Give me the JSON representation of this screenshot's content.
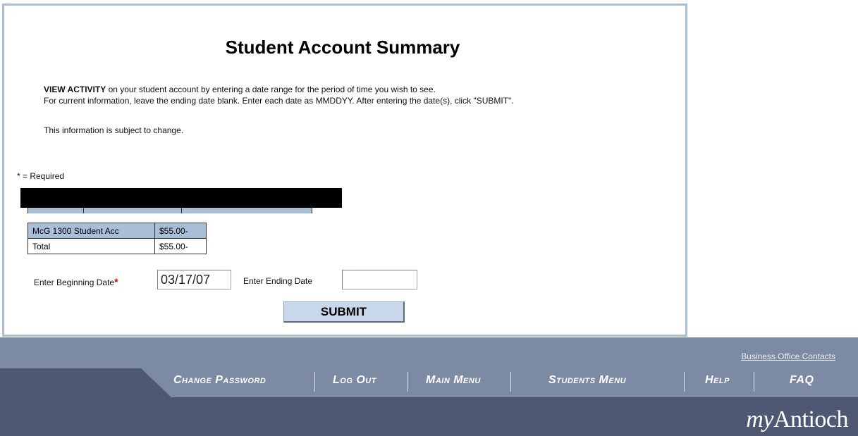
{
  "page": {
    "title": "Student Account Summary",
    "intro_bold": "VIEW ACTIVITY",
    "intro_rest": " on your student account by entering a date range for the period of time you wish to see.",
    "intro_line2": "For current information, leave the ending date blank. Enter each date as MMDDYY. After entering the date(s), click \"SUBMIT\".",
    "note": "This information is subject to change.",
    "required_note": "* = Required"
  },
  "student_row": [
    "",
    "",
    ""
  ],
  "account_table": {
    "rows": [
      {
        "label": "McG 1300 Student Acc",
        "amount": "$55.00-"
      },
      {
        "label": "Total",
        "amount": "$55.00-"
      }
    ]
  },
  "form": {
    "begin_label": "Enter Beginning Date",
    "required_star": "*",
    "begin_value": "03/17/07",
    "end_label": "Enter Ending Date",
    "end_value": "",
    "submit_label": "SUBMIT"
  },
  "footer": {
    "business_link": "Business Office Contacts",
    "nav": [
      "Change Password",
      "Log Out",
      "Main Menu",
      "Students Menu",
      "Help",
      "FAQ"
    ],
    "brand_prefix": "my",
    "brand_name": "Antioch"
  },
  "colors": {
    "accent_blue": "#a9bfd8",
    "footer_light": "#7d8aa3",
    "footer_dark": "#4e5873",
    "required_red": "#cc0000"
  }
}
